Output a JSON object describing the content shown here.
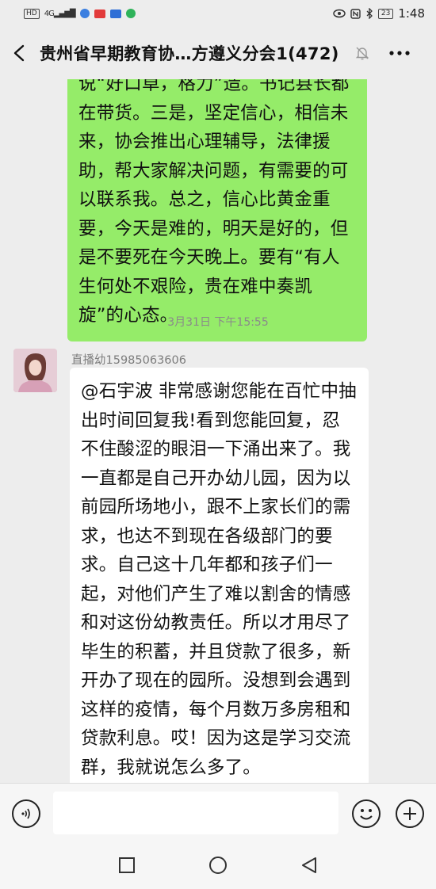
{
  "status_bar": {
    "left_icons": [
      "hd-icon",
      "signal-4g-icon",
      "app-icon-blue",
      "app-icon-red",
      "app-icon-news",
      "app-icon-green"
    ],
    "hd_label": "HD",
    "signal_label": "4G",
    "battery_level": "23",
    "time": "1:48",
    "right_icons": [
      "eye-icon",
      "nfc-icon",
      "bluetooth-icon",
      "battery-icon"
    ]
  },
  "header": {
    "title": "贵州省早期教育协…方遵义分会1(472)",
    "icons": [
      "back-icon",
      "mute-bell-icon",
      "more-icon"
    ]
  },
  "messages": {
    "outgoing_text": "说“好口卓，格力”造。书记县长都在带货。三是，坚定信心，相信未来，协会推出心理辅导，法律援助，帮大家解决问题，有需要的可以联系我。总之，信心比黄金重要，今天是难的，明天是好的，但是不要死在今天晚上。要有“有人生何处不艰险，贵在难中奏凯旋”的心态。",
    "timestamp": "3月31日 下午15:55",
    "incoming_sender": "直播幼15985063606",
    "incoming_text": "@石宇波  非常感谢您能在百忙中抽出时间回复我!看到您能回复，忍不住酸涩的眼泪一下涌出来了。我一直都是自己开办幼儿园，因为以前园所场地小，跟不上家长们的需求，也达不到现在各级部门的要求。自己这十几年都和孩子们一起，对他们产生了难以割舍的情感和对这份幼教责任。所以才用尽了毕生的积蓄，并且贷款了很多，新开办了现在的园所。没想到会遇到这样的疫情，每个月数万多房租和贷款利息。哎！因为这是学习交流群，我就说怎么多了。"
  },
  "input_bar": {
    "placeholder": "",
    "icons": [
      "voice-icon",
      "emoji-icon",
      "plus-icon"
    ]
  },
  "nav_bar": {
    "icons": [
      "recent-apps-icon",
      "home-icon",
      "back-nav-icon"
    ]
  },
  "colors": {
    "background": "#ededed",
    "outgoing_bubble": "#95ec69",
    "incoming_bubble": "#ffffff",
    "meta_text": "#8a8a8a"
  }
}
